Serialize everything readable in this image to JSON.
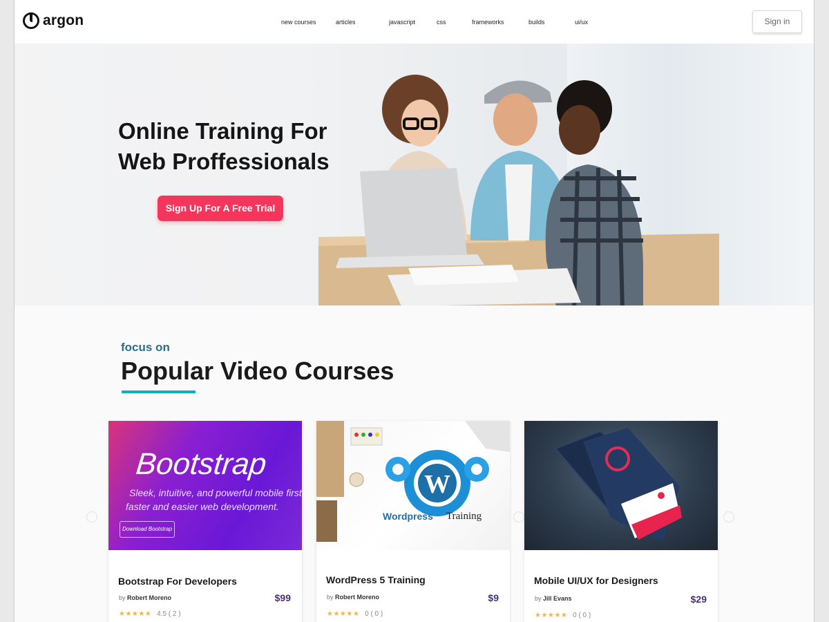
{
  "header": {
    "logo_text": "argon",
    "nav": [
      "new courses",
      "articles",
      "javascript",
      "css",
      "frameworks",
      "builds",
      "ui/ux"
    ],
    "signin_label": "Sign in"
  },
  "hero": {
    "title_line1": "Online Training For",
    "title_line2": "Web Proffessionals",
    "cta_label": "Sign Up For A Free Trial"
  },
  "section": {
    "kicker": "focus on",
    "title": "Popular Video Courses"
  },
  "cards": [
    {
      "image_heading": "Bootstrap",
      "image_line1": "Sleek, intuitive, and powerful mobile first fron",
      "image_line2": "faster and easier web development.",
      "image_button": "Download Bootstrap",
      "title": "Bootstrap For Developers",
      "author_prefix": "by",
      "author": "Robert Moreno",
      "price": "$99",
      "stars": "★★★★★",
      "rating": "4.5",
      "count": "( 2 )"
    },
    {
      "image_heading": "Wordpress",
      "image_heading2": "Training",
      "title": "WordPress  5 Training",
      "author_prefix": "by",
      "author": "Robert Moreno",
      "price": "$9",
      "stars": "★★★★★",
      "rating": "0",
      "count": "( 0 )"
    },
    {
      "title": "Mobile UI/UX for Designers",
      "author_prefix": "by",
      "author": "Jill Evans",
      "price": "$29",
      "stars": "★★★★★",
      "rating": "0",
      "count": "( 0 )"
    }
  ],
  "colors": {
    "accent": "#f5365c",
    "teal": "#11aebd",
    "price": "#4b2f7a",
    "star": "#f4b63a"
  }
}
